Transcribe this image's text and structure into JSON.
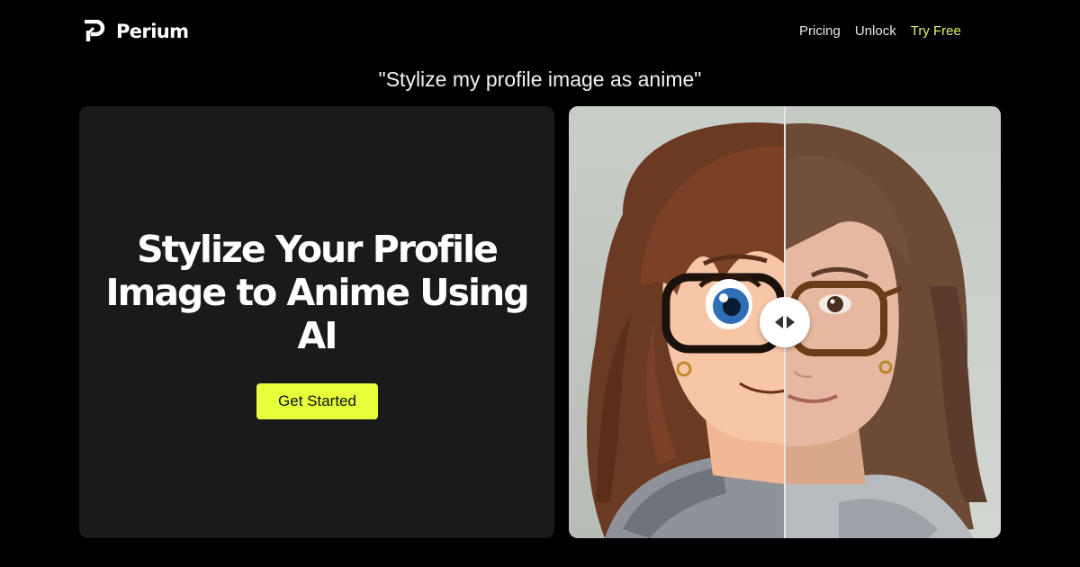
{
  "brand": {
    "name": "Perium",
    "icon": "perium-logo-icon"
  },
  "nav": [
    {
      "label": "Pricing"
    },
    {
      "label": "Unlock"
    },
    {
      "label": "Try Free"
    }
  ],
  "prompt": "\"Stylize my profile image as anime\"",
  "hero": {
    "title": "Stylize Your Profile Image to Anime Using AI",
    "cta_label": "Get Started"
  },
  "comparison": {
    "before_label": "anime-portrait-half",
    "after_label": "photo-portrait-half",
    "slider_position": 0.5,
    "handle_icon": "left-right-arrows-icon"
  },
  "colors": {
    "accent": "#e6ff3a",
    "nav_accent": "#e3f46a",
    "card_bg": "#1a1a1a",
    "page_bg": "#000000"
  }
}
